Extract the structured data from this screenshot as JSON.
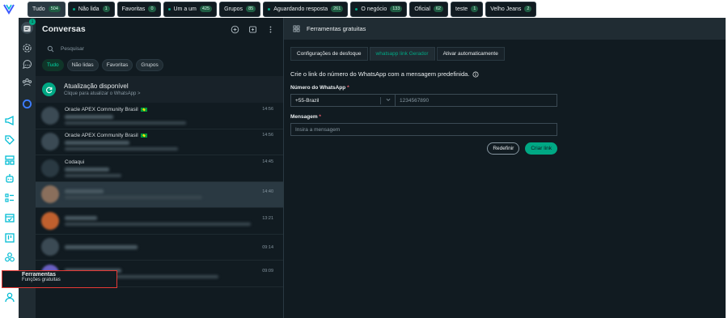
{
  "filters": [
    {
      "label": "Tudo",
      "count": "504",
      "active": true,
      "dot": false
    },
    {
      "label": "Não lida",
      "count": "1",
      "active": false,
      "dot": true
    },
    {
      "label": "Favoritas",
      "count": "0",
      "active": false,
      "dot": false
    },
    {
      "label": "Um a um",
      "count": "425",
      "active": false,
      "dot": true
    },
    {
      "label": "Grupos",
      "count": "85",
      "active": false,
      "dot": false
    },
    {
      "label": "Aguardando resposta",
      "count": "261",
      "active": false,
      "dot": true
    },
    {
      "label": "O negócio",
      "count": "133",
      "active": false,
      "dot": true
    },
    {
      "label": "Oficial",
      "count": "62",
      "active": false,
      "dot": false
    },
    {
      "label": "teste",
      "count": "1",
      "active": false,
      "dot": false
    },
    {
      "label": "Velho Jeans",
      "count": "2",
      "active": false,
      "dot": false
    }
  ],
  "rail": {
    "notification_count": "1",
    "tooltip_title": "Ferramentas",
    "tooltip_subtitle": "Funções gratuitas"
  },
  "conversations": {
    "title": "Conversas",
    "search_placeholder": "Pesquisar",
    "tabs": [
      "Tudo",
      "Não lidas",
      "Favoritas",
      "Grupos"
    ],
    "update_title": "Atualização disponível",
    "update_subtitle": "Clique para atualizar o WhatsApp >",
    "rows": [
      {
        "name": "Oracle APEX Community Brasil",
        "flag": true,
        "time": "14:56",
        "selected": false
      },
      {
        "name": "Oracle APEX Community Brasil",
        "flag": true,
        "time": "14:56",
        "selected": false
      },
      {
        "name": "Codaqui",
        "flag": false,
        "time": "14:45",
        "selected": false
      },
      {
        "name": "",
        "flag": false,
        "time": "14:40",
        "selected": true
      },
      {
        "name": "",
        "flag": false,
        "time": "13:21",
        "selected": false
      },
      {
        "name": "",
        "flag": false,
        "time": "09:14",
        "selected": false
      },
      {
        "name": "",
        "flag": false,
        "time": "09:09",
        "selected": false
      }
    ]
  },
  "panel": {
    "header_title": "Ferramentas gratuitas",
    "tabs": [
      "Configurações de desfoque",
      "whatsapp link Gerador",
      "Ativar automaticamente"
    ],
    "active_tab": 1,
    "intro": "Crie o link do número do WhatsApp com a mensagem predefinida.",
    "phone_label": "Número do WhatsApp",
    "country_code": "+55-Brazil",
    "phone_placeholder": "1234567890",
    "message_label": "Mensagem",
    "message_placeholder": "Insira a mensagem",
    "reset_label": "Redefinir",
    "create_label": "Criar link"
  },
  "colors": {
    "accent": "#00a884",
    "background": "#111b21",
    "panel": "#202c33",
    "tooltip_border": "#e53935",
    "rail_icon": "#00bcd4"
  }
}
